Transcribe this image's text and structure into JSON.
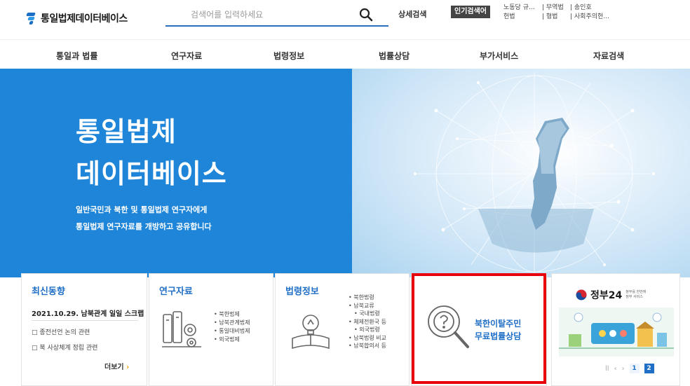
{
  "header": {
    "logo_text": "통일법제데이터베이스",
    "search_placeholder": "검색어를 입력하세요",
    "detail_search": "상세검색",
    "popular_label": "인기검색어",
    "popular_row1": [
      "노동당 규...",
      "| 무역법",
      "| 송인호"
    ],
    "popular_row2": [
      "헌법",
      "| 형법",
      "| 사회주의헌..."
    ]
  },
  "nav": {
    "items": [
      "통일과 법률",
      "연구자료",
      "법령정보",
      "법률상담",
      "부가서비스",
      "자료검색"
    ]
  },
  "hero": {
    "title_line1": "통일법제",
    "title_line2": "데이터베이스",
    "subtitle_line1": "일반국민과 북한 및 통일법제 연구자에게",
    "subtitle_line2": "통일법제 연구자료를 개방하고 공유합니다"
  },
  "news": {
    "title": "최신동향",
    "headline": "2021.10.29. 남북관계 일일 스크랩",
    "items": [
      "□ 종전선언 논의 관련",
      "□ 북 사상체계 정립 관련"
    ],
    "more": "더보기"
  },
  "research": {
    "title": "연구자료",
    "items": [
      "북한법제",
      "남북관계법제",
      "통일대비법제",
      "외국법제"
    ]
  },
  "lawinfo": {
    "title": "법령정보",
    "items": [
      "북한법령",
      "남북교류",
      "국내법령",
      "체제전환국 등",
      "외국법령",
      "남북법령 비교",
      "남북합의서 등"
    ]
  },
  "consult": {
    "line1": "북한이탈주민",
    "line2": "무료법률상담"
  },
  "gov24": {
    "name": "정부24",
    "small_line1": "정부를 한번에",
    "small_line2": "정부 서비스",
    "pages": [
      "1",
      "2"
    ]
  },
  "colors": {
    "accent": "#1f6fc6",
    "hero_blue": "#1e85d8",
    "highlight_frame": "#e8000b"
  }
}
